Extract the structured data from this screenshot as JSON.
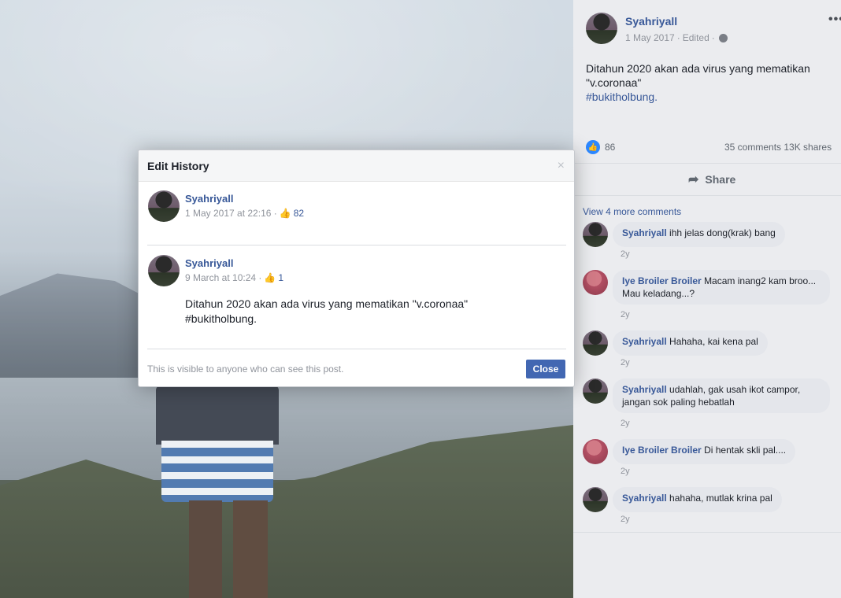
{
  "post": {
    "author": "Syahriyall",
    "date": "1 May 2017",
    "edited": "Edited",
    "separator": "·",
    "text": "Ditahun 2020 akan ada virus yang mematikan \"v.coronaa\"",
    "hashtag": "#bukitholbung.",
    "like_count": "86",
    "stats": "35 comments  13K shares",
    "share_label": "Share",
    "more_comments": "View 4 more comments"
  },
  "comments": [
    {
      "author": "Syahriyall",
      "text": "ihh jelas dong(krak) bang",
      "age": "2y"
    },
    {
      "author": "Iye Broiler Broiler",
      "text": "Macam inang2 kam broo... Mau keladang...?",
      "age": "2y"
    },
    {
      "author": "Syahriyall",
      "text": "Hahaha, kai kena pal",
      "age": "2y"
    },
    {
      "author": "Syahriyall",
      "text": "udahlah, gak usah ikot campor, jangan sok paling hebatlah",
      "age": "2y"
    },
    {
      "author": "Iye Broiler Broiler",
      "text": "Di hentak skli pal....",
      "age": "2y"
    },
    {
      "author": "Syahriyall",
      "text": "hahaha, mutlak krina pal",
      "age": "2y"
    }
  ],
  "modal": {
    "title": "Edit History",
    "close_x": "×",
    "entries": [
      {
        "author": "Syahriyall",
        "meta": "1 May 2017 at 22:16 ·",
        "count": "82",
        "text": ""
      },
      {
        "author": "Syahriyall",
        "meta": "9 March at 10:24 ·",
        "count": "1",
        "text": "Ditahun 2020 akan ada virus yang mematikan \"v.coronaa\" #bukitholbung."
      }
    ],
    "footer_note": "This is visible to anyone who can see this post.",
    "close_label": "Close"
  },
  "icons": {
    "more": "more-horizontal-icon",
    "globe": "globe-icon",
    "like": "thumbs-up-icon",
    "share": "share-arrow-icon",
    "close": "close-icon"
  },
  "colors": {
    "brand": "#385898",
    "button": "#4267b2",
    "like_badge": "#2d88ff"
  }
}
